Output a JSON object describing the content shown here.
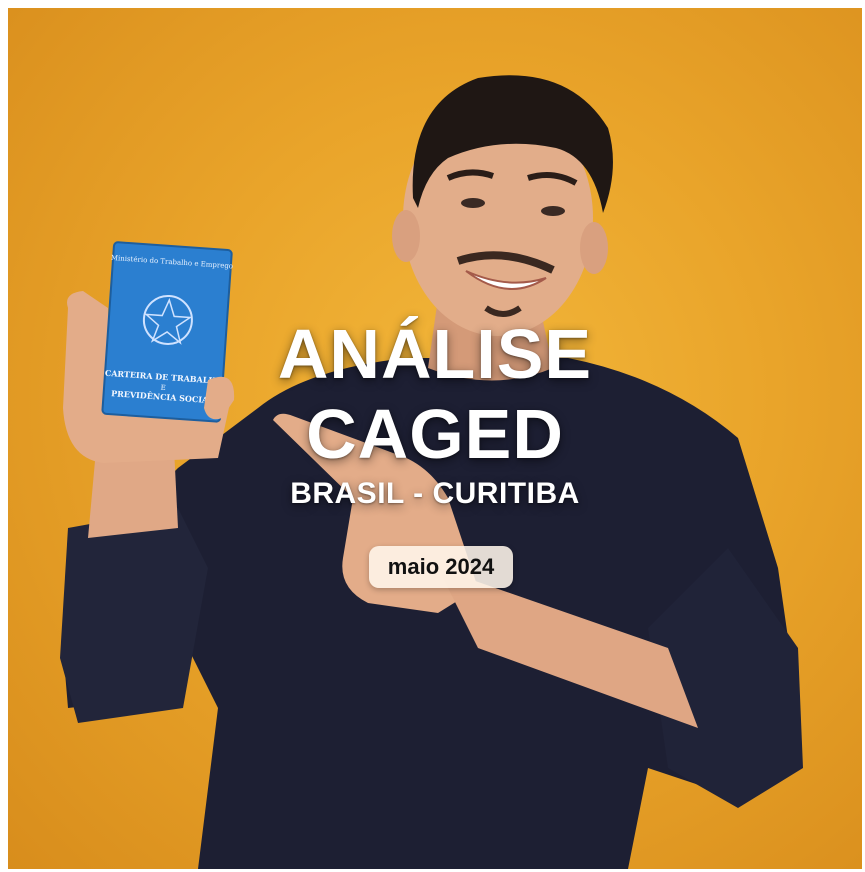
{
  "overlay": {
    "title_line1": "ANÁLISE",
    "title_line2": "CAGED",
    "subtitle": "BRASIL - CURITIBA",
    "date_badge": "maio 2024"
  },
  "booklet": {
    "header": "Ministério do Trabalho e Emprego",
    "title_line1": "CARTEIRA DE TRABALHO",
    "title_line2": "E",
    "title_line3": "PREVIDÊNCIA SOCIAL"
  },
  "colors": {
    "background": "#e9a42a",
    "sweater": "#1d1f33",
    "booklet": "#2b7fd0",
    "text": "#ffffff"
  }
}
